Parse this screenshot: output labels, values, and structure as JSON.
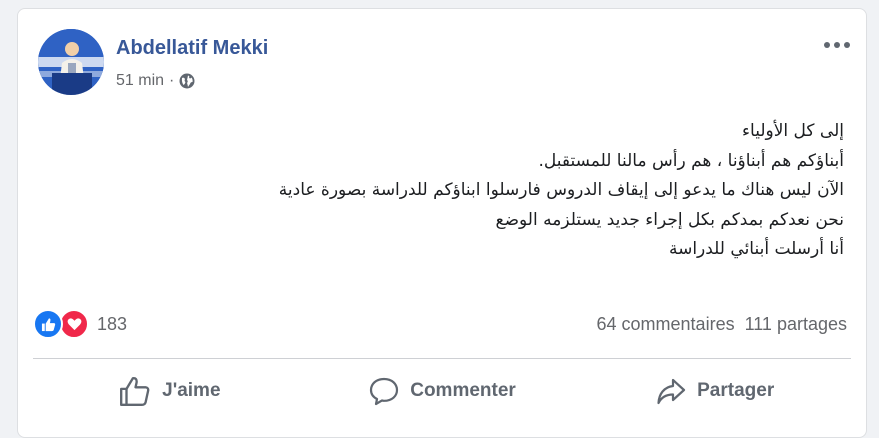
{
  "post": {
    "author": "Abdellatif Mekki",
    "time": "51 min",
    "time_separator": "·",
    "audience_icon": "globe-icon",
    "options_icon": "more-icon",
    "text_lines": [
      "إلى كل الأولياء",
      "أبناؤكم هم أبناؤنا ، هم رأس مالنا للمستقبل.",
      "الآن ليس هناك ما يدعو إلى إيقاف الدروس فارسلوا ابناؤكم للدراسة بصورة عادية",
      "نحن نعدكم بمدكم بكل إجراء جديد يستلزمه الوضع",
      "أنا أرسلت أبنائي للدراسة"
    ]
  },
  "stats": {
    "reaction_icons": [
      "like-icon",
      "love-icon"
    ],
    "reaction_count": "183",
    "comments": "64 commentaires",
    "shares": "111 partages"
  },
  "actions": {
    "like_label": "J'aime",
    "comment_label": "Commenter",
    "share_label": "Partager"
  },
  "colors": {
    "author": "#385898",
    "like": "#1877f2",
    "love": "#f0284a",
    "muted": "#65676b"
  }
}
